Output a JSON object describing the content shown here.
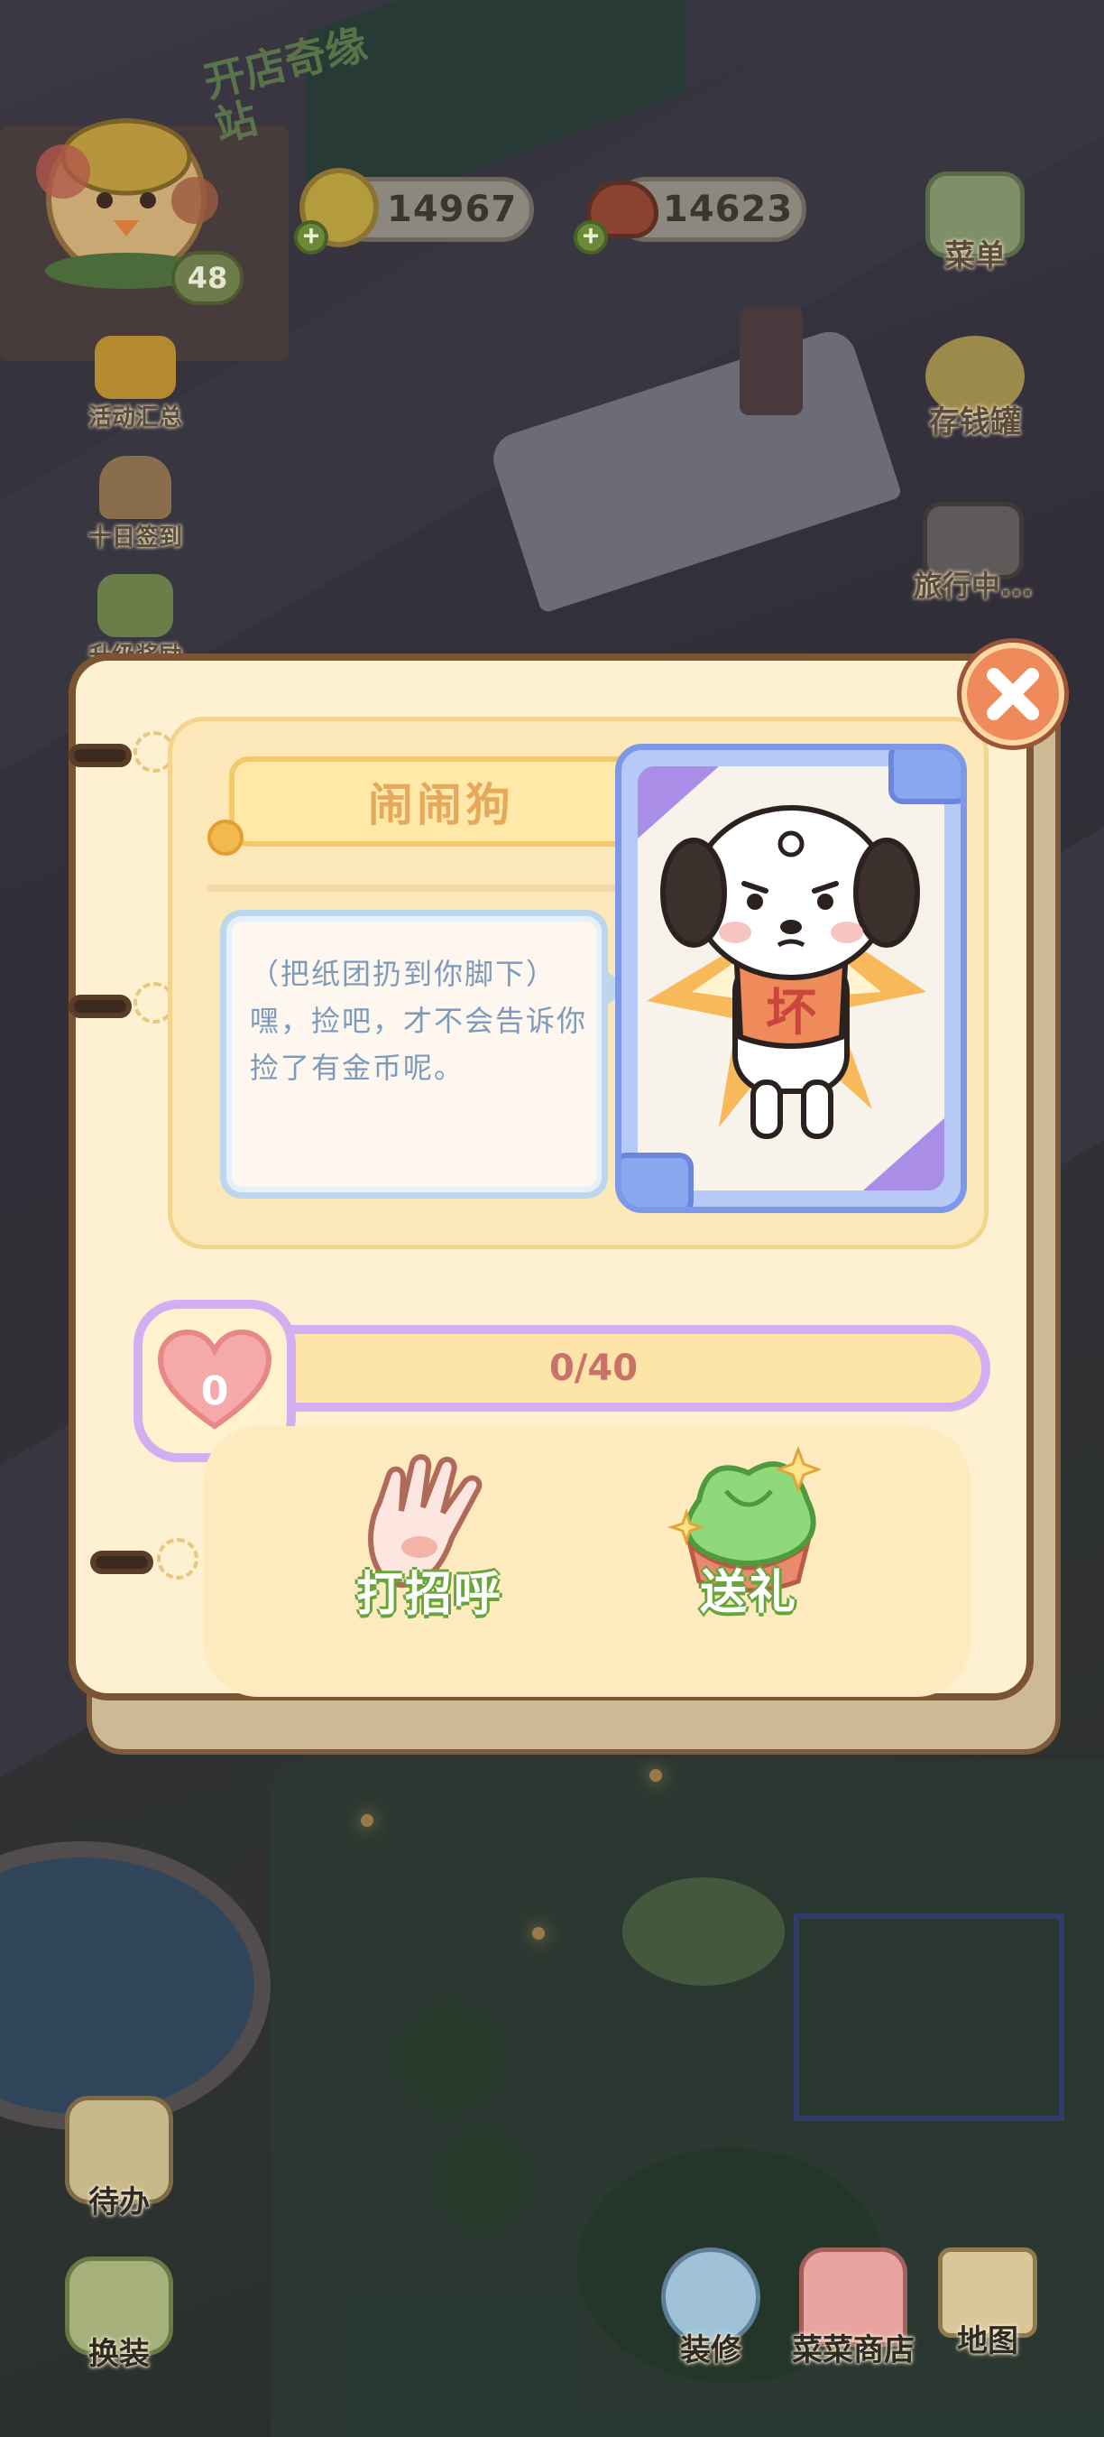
{
  "game": {
    "logo_text": "开店奇缘站",
    "player_level": "48"
  },
  "currencies": [
    {
      "name": "coin",
      "amount": "14967"
    },
    {
      "name": "meat",
      "amount": "14623"
    }
  ],
  "left_menu": [
    {
      "label": "活动汇总",
      "icon": "event-gift-icon"
    },
    {
      "label": "十日签到",
      "icon": "checkin-basket-icon"
    },
    {
      "label": "升级奖励",
      "icon": "level-reward-icon"
    }
  ],
  "right_menu": [
    {
      "label": "菜单",
      "icon": "menu-tv-icon"
    },
    {
      "label": "存钱罐",
      "icon": "piggy-bank-icon"
    },
    {
      "label": "旅行中...",
      "icon": "camera-icon"
    }
  ],
  "bottom_left": [
    {
      "label": "待办",
      "icon": "todo-clipboard-icon"
    },
    {
      "label": "换装",
      "icon": "wardrobe-icon"
    }
  ],
  "bottom_right": [
    {
      "label": "装修",
      "icon": "decorate-icon"
    },
    {
      "label": "菜菜商店",
      "icon": "shop-icon"
    },
    {
      "label": "地图",
      "icon": "map-icon"
    }
  ],
  "dialog": {
    "character_name": "闹闹狗",
    "speech": "（把纸团扔到你脚下）嘿，捡吧，才不会告诉你捡了有金币呢。",
    "shirt_char": "坏",
    "affection": {
      "hearts": "0",
      "progress_text": "0/40",
      "value": 0,
      "max": 40
    },
    "actions": [
      {
        "label": "打招呼",
        "icon": "wave-hand-icon"
      },
      {
        "label": "送礼",
        "icon": "gift-icon"
      }
    ]
  },
  "colors": {
    "page": "#fdf1d2",
    "border": "#7b5434",
    "bar_border": "#d3aef2",
    "action_text_outline": "#68a63a",
    "close": "#ef8a5a"
  }
}
